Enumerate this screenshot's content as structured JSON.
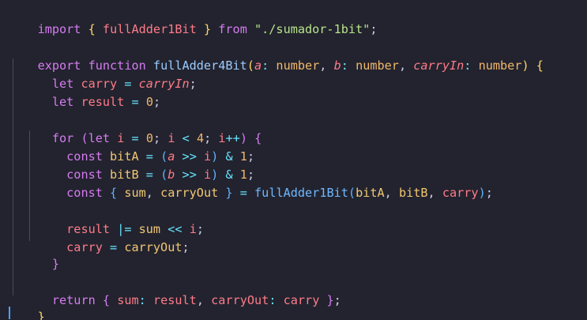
{
  "code_lines": [
    "import { fullAdder1Bit } from \"./sumador-1bit\";",
    "",
    "export function fullAdder4Bit(a: number, b: number, carryIn: number) {",
    "  let carry = carryIn;",
    "  let result = 0;",
    "",
    "  for (let i = 0; i < 4; i++) {",
    "    const bitA = (a >> i) & 1;",
    "    const bitB = (b >> i) & 1;",
    "    const { sum, carryOut } = fullAdder1Bit(bitA, bitB, carry);",
    "",
    "    result |= sum << i;",
    "    carry = carryOut;",
    "  }",
    "",
    "  return { sum: result, carryOut: carry };",
    "}"
  ],
  "tokens": {
    "l1": {
      "import": "import",
      "ob": "{",
      "name": "fullAdder1Bit",
      "cb": "}",
      "from": "from",
      "path": "\"./sumador-1bit\"",
      "semi": ";"
    },
    "l3": {
      "export": "export",
      "function": "function",
      "name": "fullAdder4Bit",
      "op": "(",
      "a": "a",
      "colon1": ":",
      "t1": "number",
      "c1": ",",
      "b": "b",
      "colon2": ":",
      "t2": "number",
      "c2": ",",
      "carryIn": "carryIn",
      "colon3": ":",
      "t3": "number",
      "cp": ")",
      "ob": "{"
    },
    "l4": {
      "let": "let",
      "carry": "carry",
      "eq": "=",
      "carryIn": "carryIn",
      "semi": ";"
    },
    "l5": {
      "let": "let",
      "result": "result",
      "eq": "=",
      "zero": "0",
      "semi": ";"
    },
    "l7": {
      "for": "for",
      "op": "(",
      "let": "let",
      "i1": "i",
      "eq": "=",
      "zero": "0",
      "semi1": ";",
      "i2": "i",
      "lt": "<",
      "four": "4",
      "semi2": ";",
      "i3": "i",
      "inc": "++",
      "cp": ")",
      "ob": "{"
    },
    "l8": {
      "const": "const",
      "bitA": "bitA",
      "eq": "=",
      "op": "(",
      "a": "a",
      "shr": ">>",
      "i": "i",
      "cp": ")",
      "amp": "&",
      "one": "1",
      "semi": ";"
    },
    "l9": {
      "const": "const",
      "bitB": "bitB",
      "eq": "=",
      "op": "(",
      "b": "b",
      "shr": ">>",
      "i": "i",
      "cp": ")",
      "amp": "&",
      "one": "1",
      "semi": ";"
    },
    "l10": {
      "const": "const",
      "ob": "{",
      "sum": "sum",
      "comma1": ",",
      "carryOut": "carryOut",
      "cb": "}",
      "eq": "=",
      "fn": "fullAdder1Bit",
      "op": "(",
      "bitA": "bitA",
      "comma2": ",",
      "bitB": "bitB",
      "comma3": ",",
      "carry": "carry",
      "cp": ")",
      "semi": ";"
    },
    "l12": {
      "result": "result",
      "oreq": "|=",
      "sum": "sum",
      "shl": "<<",
      "i": "i",
      "semi": ";"
    },
    "l13": {
      "carry": "carry",
      "eq": "=",
      "carryOut": "carryOut",
      "semi": ";"
    },
    "l14": {
      "cb": "}"
    },
    "l16": {
      "return": "return",
      "ob": "{",
      "sumkey": "sum",
      "colon1": ":",
      "result": "result",
      "comma": ",",
      "carryOutKey": "carryOut",
      "colon2": ":",
      "carry": "carry",
      "cb": "}",
      "semi": ";"
    },
    "l17": {
      "cb": "}"
    }
  },
  "colors": {
    "background": "#22232e",
    "keyword": "#d67bf2",
    "function": "#9bcbff",
    "identifier": "#ff7b8a",
    "type": "#f2b86b",
    "string": "#b8e38a",
    "operator": "#67e3ff",
    "caret": "#4ea1ff"
  }
}
